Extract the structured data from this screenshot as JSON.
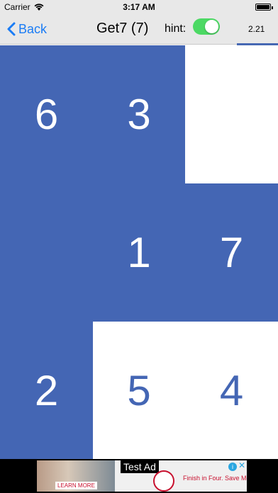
{
  "status_bar": {
    "carrier": "Carrier",
    "time": "3:17 AM",
    "icons": [
      "wifi-icon",
      "battery-icon"
    ]
  },
  "nav": {
    "back_label": "Back",
    "title": "Get7 (7)",
    "hint_label": "hint:",
    "hint_on": true,
    "score": "2.21"
  },
  "colors": {
    "tile_blue": "#4466b4",
    "toggle_on": "#4cd964",
    "link_blue": "#1a7cf5"
  },
  "board": {
    "rows": [
      [
        {
          "value": "6",
          "color": "blue"
        },
        {
          "value": "3",
          "color": "blue"
        },
        {
          "value": "",
          "color": "white"
        }
      ],
      [
        {
          "value": "",
          "color": "blue"
        },
        {
          "value": "1",
          "color": "blue"
        },
        {
          "value": "7",
          "color": "blue"
        }
      ],
      [
        {
          "value": "2",
          "color": "blue"
        },
        {
          "value": "5",
          "color": "white"
        },
        {
          "value": "4",
          "color": "white"
        }
      ]
    ]
  },
  "ad": {
    "label": "Test Ad",
    "learn_more": "LEARN MORE",
    "tagline": "Finish in Four. Save Mor",
    "info_icon": "info-icon",
    "close_icon": "close-icon"
  }
}
